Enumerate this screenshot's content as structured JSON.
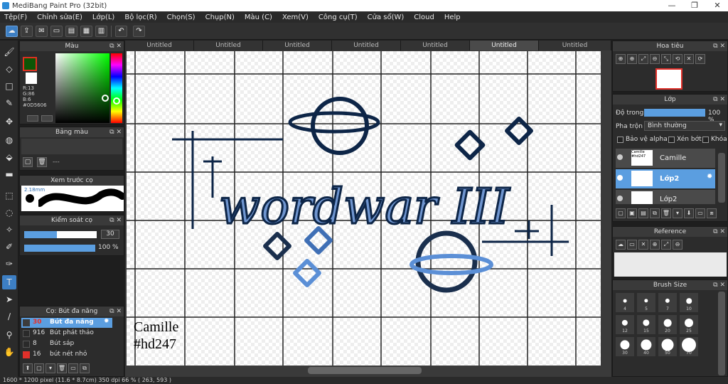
{
  "window": {
    "title": "MediBang Paint Pro (32bit)",
    "controls": [
      "—",
      "❐",
      "✕"
    ]
  },
  "menu": [
    "Tệp(F)",
    "Chỉnh sửa(E)",
    "Lớp(L)",
    "Bộ lọc(R)",
    "Chọn(S)",
    "Chụp(N)",
    "Màu (C)",
    "Xem(V)",
    "Công cụ(T)",
    "Cửa sổ(W)",
    "Cloud",
    "Help"
  ],
  "tabs": [
    "Untitled",
    "Untitled",
    "Untitled",
    "Untitled",
    "Untitled",
    "Untitled",
    "Untitled"
  ],
  "color_panel": {
    "title": "Màu",
    "r": "R:13",
    "g": "G:86",
    "b": "B:6",
    "hex": "#0D5606",
    "fg_color": "#0d5606"
  },
  "palette_panel": {
    "title": "Bảng màu",
    "empty": "---"
  },
  "brush_preview": {
    "title": "Xem trước cọ",
    "size": "2.18mm"
  },
  "brush_control": {
    "title": "Kiểm soát cọ",
    "size": "30",
    "size_fill": 0.45,
    "opacity": "100 %",
    "opacity_fill": 1.0
  },
  "brush_list": {
    "title": "Cọ: Bút đa năng",
    "items": [
      {
        "size": "30",
        "name": "Bút đa năng",
        "color": "#3c3c3c"
      },
      {
        "size": "916",
        "name": "Bút phát thảo",
        "color": "#2a2a2a"
      },
      {
        "size": "8",
        "name": "Bút sáp",
        "color": "#2a2a2a"
      },
      {
        "size": "16",
        "name": "bút nét nhỏ",
        "color": "#e0302a"
      }
    ]
  },
  "canvas": {
    "signature_line1": "Camille",
    "signature_line2": "#hd247",
    "art_text": "wordwar III"
  },
  "navigator": {
    "title": "Hoa tiêu"
  },
  "layers": {
    "title": "Lớp",
    "opacity_label": "Độ trong",
    "opacity": "100 %",
    "opacity_fill": 1.0,
    "blend_label": "Pha trộn",
    "blend": "Bình thường",
    "protect_alpha": "Bảo vệ alpha",
    "clipping": "Xén bớt",
    "lock": "Khóa",
    "items": [
      {
        "name": "Camille",
        "thumb": "Camille #hd247"
      },
      {
        "name": "Lớp2"
      },
      {
        "name": "Lớp2"
      }
    ]
  },
  "reference": {
    "title": "Reference"
  },
  "brush_size": {
    "title": "Brush Size",
    "sizes": [
      "4",
      "5",
      "7",
      "10",
      "12",
      "15",
      "20",
      "25",
      "30",
      "40",
      "50",
      "70"
    ]
  },
  "status": {
    "text": "1600 * 1200 pixel   (11.6 * 8.7cm)   350 dpi   66 %   ( 263, 593 )"
  }
}
